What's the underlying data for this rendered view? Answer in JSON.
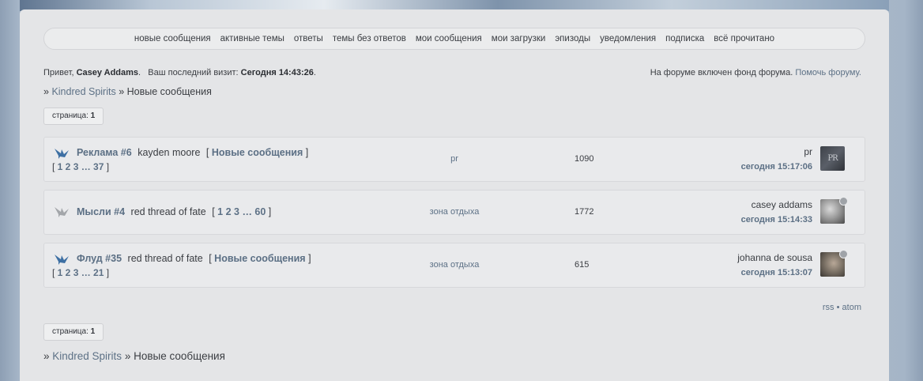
{
  "nav": [
    {
      "label": "новые сообщения"
    },
    {
      "label": "активные темы"
    },
    {
      "label": "ответы"
    },
    {
      "label": "темы без ответов"
    },
    {
      "label": "мои сообщения"
    },
    {
      "label": "мои загрузки"
    },
    {
      "label": "эпизоды"
    },
    {
      "label": "уведомления"
    },
    {
      "label": "подписка"
    },
    {
      "label": "всё прочитано"
    }
  ],
  "greeting": {
    "prefix": "Привет, ",
    "username": "Casey Addams",
    "middle": ".   Ваш последний визит: ",
    "last_visit": "Сегодня 14:43:26",
    "suffix": "."
  },
  "fund": {
    "text": "На форуме включен фонд форума. ",
    "link": "Помочь форуму."
  },
  "breadcrumb": {
    "sep": "» ",
    "forum": "Kindred Spirits",
    "sep2": " » ",
    "current": "Новые сообщения"
  },
  "pager": {
    "label": "страница: ",
    "page": "1"
  },
  "topics": [
    {
      "title": "Реклама #6",
      "author": "kayden moore",
      "new_link": "Новые сообщения",
      "pages": "1 2 3 … 37",
      "category": "pr",
      "count": "1090",
      "last_user": "pr",
      "last_date": "сегодня 15:17:06",
      "icon": "bird-icon-new",
      "avatar_text": "PR"
    },
    {
      "title": "Мысли #4",
      "author": "red thread of fate",
      "pages": "1 2 3 … 60",
      "category": "зона отдыха",
      "count": "1772",
      "last_user": "casey addams",
      "last_date": "сегодня 15:14:33",
      "icon": "bird-icon-read"
    },
    {
      "title": "Флуд #35",
      "author": "red thread of fate",
      "new_link": "Новые сообщения",
      "pages": "1 2 3 … 21",
      "category": "зона отдыха",
      "count": "615",
      "last_user": "johanna de sousa",
      "last_date": "сегодня 15:13:07",
      "icon": "bird-icon-new"
    }
  ],
  "feeds": {
    "rss": "rss",
    "sep": " • ",
    "atom": "atom"
  },
  "colors": {
    "link": "#5b6f84",
    "icon_new": "#3d6fa3",
    "icon_read": "#a3a6aa",
    "panel": "#e4e5e7"
  }
}
